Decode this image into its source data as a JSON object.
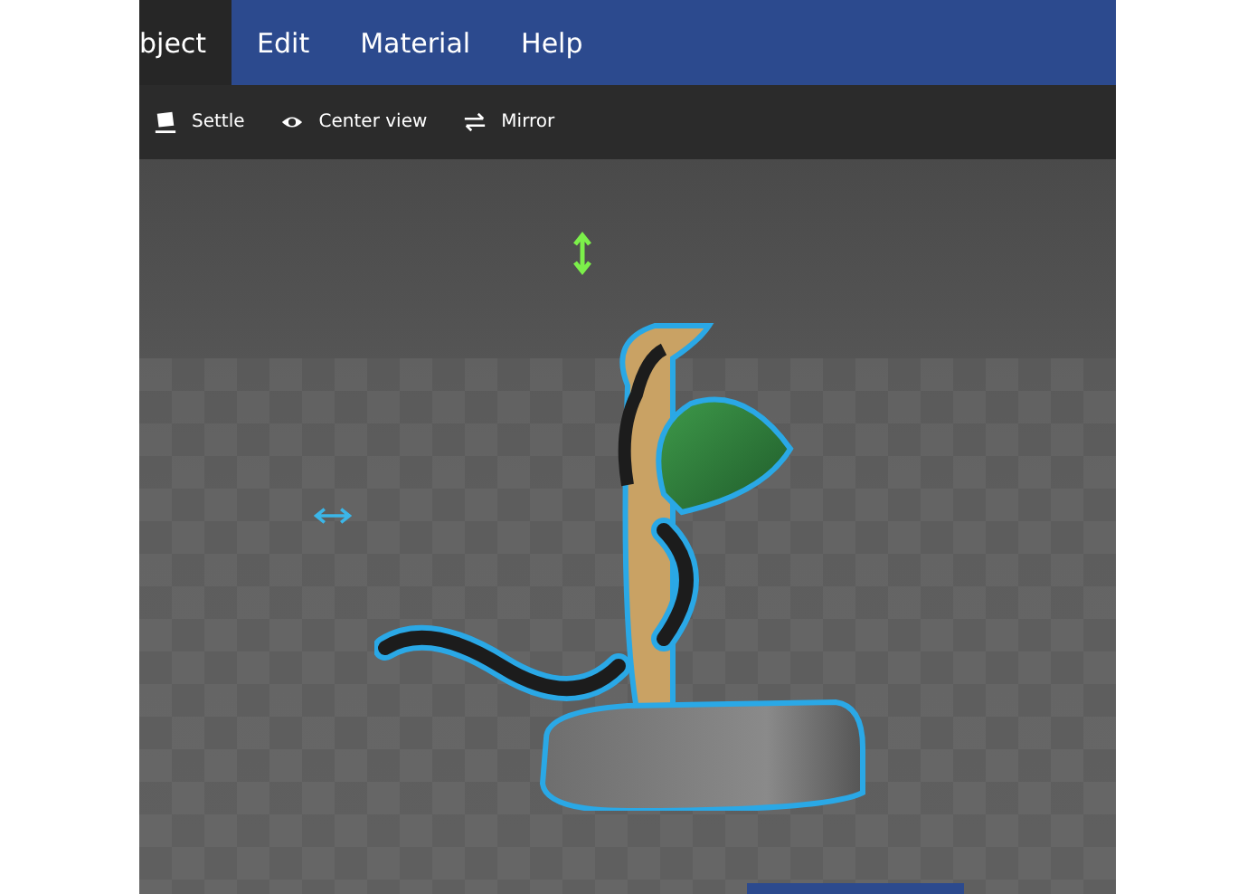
{
  "menu": {
    "tabs": [
      {
        "label": "bject",
        "selected": true
      },
      {
        "label": "Edit",
        "selected": false
      },
      {
        "label": "Material",
        "selected": false
      },
      {
        "label": "Help",
        "selected": false
      }
    ]
  },
  "toolbar": {
    "buttons": [
      {
        "label": "Settle",
        "kind": "settle"
      },
      {
        "label": "Center view",
        "kind": "eye"
      },
      {
        "label": "Mirror",
        "kind": "mirror"
      }
    ]
  }
}
